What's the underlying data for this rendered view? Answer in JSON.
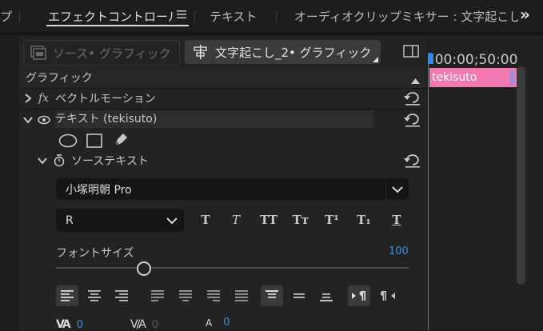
{
  "tabs": {
    "partial_left": "プ",
    "effect_controls": "エフェクトコントロール",
    "text": "テキスト",
    "audio_mixer": "オーディオクリップミキサー : 文字起こし",
    "overflow": "»"
  },
  "source": {
    "source_label": "ソース• グラフィック",
    "clip_label": "文字起こし_2• グラフィック"
  },
  "section": {
    "title": "グラフィック"
  },
  "effects": {
    "vector_motion": "ベクトルモーション",
    "fx": "fx",
    "text_layer": "テキスト (tekisuto)",
    "source_text": "ソーステキスト"
  },
  "font": {
    "family": "小塚明朝 Pro",
    "style": "R",
    "size_label": "フォントサイズ",
    "size_value": "100",
    "size_fraction": 0.25
  },
  "text_style_buttons": [
    "T",
    "T",
    "TT",
    "Tт",
    "T¹",
    "T₁",
    "T"
  ],
  "tracking": {
    "kerning_value": "0",
    "tracking_value": "0",
    "baseline_value": "0"
  },
  "timeline": {
    "timecode": ":00:00;50:00",
    "clip_label": "tekisuto"
  },
  "colors": {
    "clip_pink": "#f27ab0",
    "accent_blue": "#2d8ceb",
    "value_blue": "#3d8fdc"
  }
}
